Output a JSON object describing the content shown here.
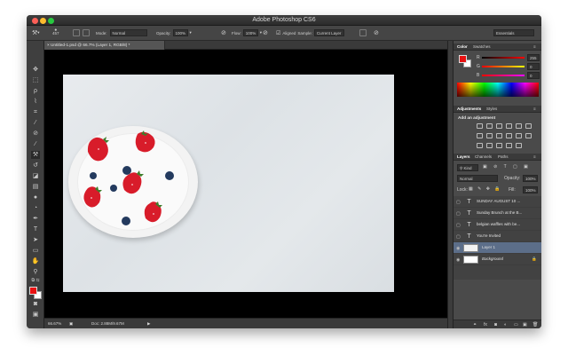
{
  "app": {
    "title": "Adobe Photoshop CS6",
    "workspace": "Essentials"
  },
  "options": {
    "brush_size": "457",
    "mode_label": "Mode:",
    "mode_value": "Normal",
    "opacity_label": "Opacity:",
    "opacity_value": "100%",
    "flow_label": "Flow:",
    "flow_value": "100%",
    "aligned_label": "Aligned",
    "sample_label": "Sample:",
    "sample_value": "Current Layer"
  },
  "document": {
    "tab_title": "Untitled-1.psd @ 66.7% (Layer 1, RGB/8) *"
  },
  "status": {
    "zoom": "66.67%",
    "doc": "Doc: 2.88M/9.67M"
  },
  "color_panel": {
    "tabs": [
      "Color",
      "Swatches"
    ],
    "r_label": "R",
    "r_value": "255",
    "g_label": "G",
    "g_value": "0",
    "b_label": "B",
    "b_value": "0"
  },
  "adjustments_panel": {
    "tabs": [
      "Adjustments",
      "Styles"
    ],
    "heading": "Add an adjustment"
  },
  "layers_panel": {
    "tabs": [
      "Layers",
      "Channels",
      "Paths"
    ],
    "kind_label": "Kind",
    "blend_mode": "Normal",
    "opacity_label": "Opacity:",
    "opacity_value": "100%",
    "lock_label": "Lock:",
    "fill_label": "Fill:",
    "fill_value": "100%",
    "layers": [
      {
        "name": "SUNDAY AUGUST 10 ...",
        "type": "text"
      },
      {
        "name": "Sunday Brunch at the B...",
        "type": "text"
      },
      {
        "name": "belgian waffles with be...",
        "type": "text"
      },
      {
        "name": "You're Invited",
        "type": "text"
      },
      {
        "name": "Layer 1",
        "type": "pixel",
        "selected": true
      },
      {
        "name": "Background",
        "type": "pixel",
        "locked": true
      }
    ]
  },
  "colors": {
    "foreground": "#e81212",
    "background": "#ffffff",
    "selection": "#5c6e89"
  }
}
